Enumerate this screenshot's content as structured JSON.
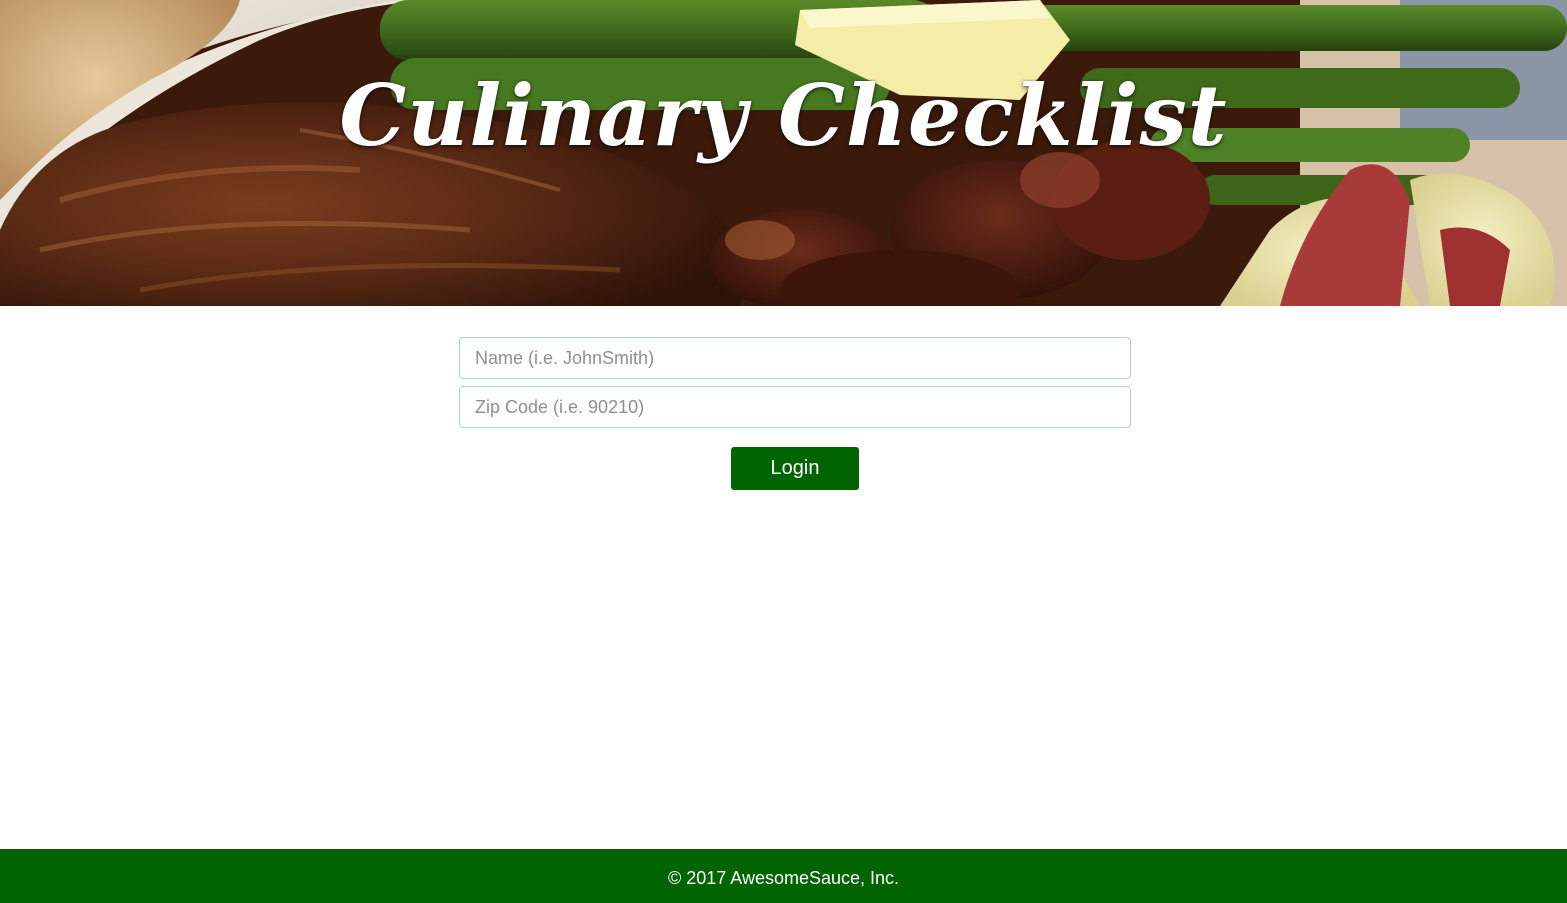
{
  "hero": {
    "title": "Culinary Checklist",
    "image": "steak-asparagus-potatoes-photo"
  },
  "login_form": {
    "name_placeholder": "Name (i.e. JohnSmith)",
    "name_value": "",
    "zip_placeholder": "Zip Code (i.e. 90210)",
    "zip_value": "",
    "login_label": "Login"
  },
  "footer": {
    "copyright": "© 2017 AwesomeSauce, Inc."
  },
  "colors": {
    "brand_green": "#006400",
    "input_border": "#a9d6e2",
    "page_background": "#ffffff"
  }
}
